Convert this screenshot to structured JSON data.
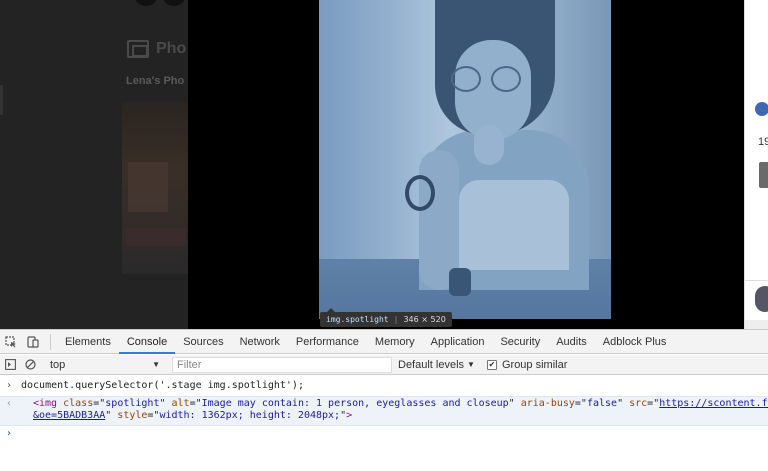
{
  "page_behind": {
    "photos_title": "Pho",
    "album_title": "Lena's Pho",
    "like_count": "19"
  },
  "tooltip": {
    "selector": "img.spotlight",
    "dimensions": "346 × 520"
  },
  "devtools": {
    "tabs": [
      "Elements",
      "Console",
      "Sources",
      "Network",
      "Performance",
      "Memory",
      "Application",
      "Security",
      "Audits",
      "Adblock Plus"
    ],
    "active_tab": "Console",
    "toolbar": {
      "context": "top",
      "filter_placeholder": "Filter",
      "levels": "Default levels",
      "group_similar": "Group similar",
      "group_similar_checked": true
    },
    "console": {
      "command": "document.querySelector('.stage img.spotlight');",
      "result_line1": {
        "open": "<img",
        "class_attr": "class",
        "class_val": "spotlight",
        "alt_attr": "alt",
        "alt_val": "Image may contain: 1 person, eyeglasses and closeup",
        "aria_attr": "aria-busy",
        "aria_val": "false",
        "src_attr": "src",
        "src_val": "https://scontent.fvca1-1.fna"
      },
      "result_line2": {
        "src_cont": "&oe=5BADB3AA",
        "style_attr": "style",
        "style_val": "width: 1362px; height: 2048px;",
        "close": ">"
      }
    }
  },
  "colors": {
    "accent": "#3879d9",
    "tag": "#881280",
    "attr_name": "#994500",
    "attr_value": "#1a1aa6",
    "highlight_overlay": "#6fa8dc"
  }
}
